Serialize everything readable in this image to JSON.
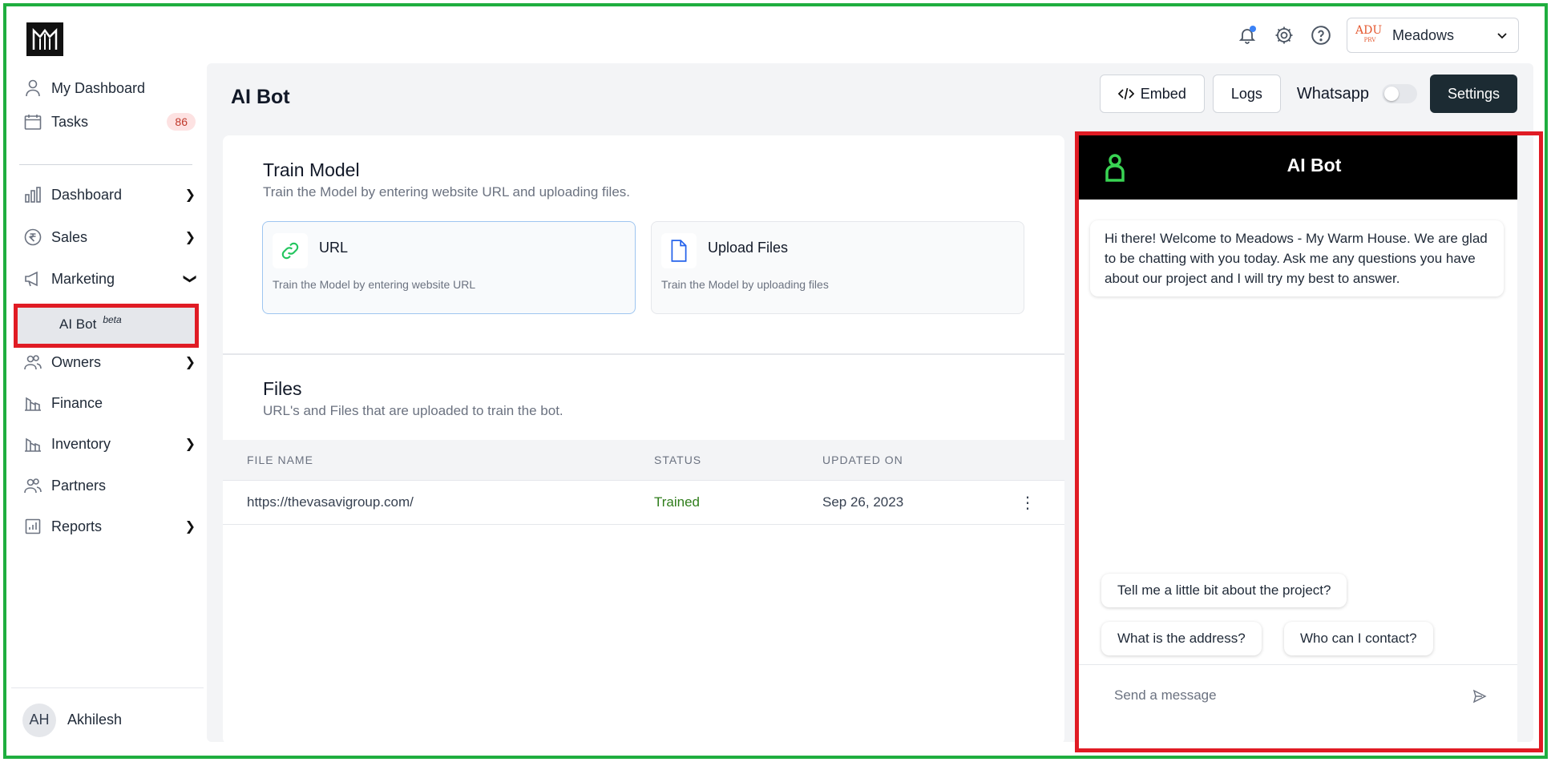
{
  "topbar": {
    "project_logo_text": "ADU",
    "project_logo_sub": "PRV",
    "project_name": "Meadows"
  },
  "sidebar": {
    "items": [
      {
        "label": "My Dashboard"
      },
      {
        "label": "Tasks",
        "badge": "86"
      },
      {
        "label": "Dashboard"
      },
      {
        "label": "Sales"
      },
      {
        "label": "Marketing"
      },
      {
        "label": "Owners"
      },
      {
        "label": "Finance"
      },
      {
        "label": "Inventory"
      },
      {
        "label": "Partners"
      },
      {
        "label": "Reports"
      }
    ],
    "sub_item": {
      "label": "AI Bot",
      "tag": "beta"
    },
    "user": {
      "initials": "AH",
      "name": "Akhilesh"
    }
  },
  "header": {
    "title": "AI Bot",
    "embed_label": "Embed",
    "logs_label": "Logs",
    "whatsapp_label": "Whatsapp",
    "whatsapp_enabled": false,
    "settings_label": "Settings"
  },
  "train": {
    "title": "Train Model",
    "subtitle": "Train the Model by entering website URL and uploading files.",
    "options": [
      {
        "label": "URL",
        "desc": "Train the Model by entering website URL"
      },
      {
        "label": "Upload Files",
        "desc": "Train the Model by uploading files"
      }
    ]
  },
  "files": {
    "title": "Files",
    "subtitle": "URL's and Files that are uploaded to train the bot.",
    "columns": [
      "FILE NAME",
      "STATUS",
      "UPDATED ON"
    ],
    "rows": [
      {
        "name": "https://thevasavigroup.com/",
        "status": "Trained",
        "updated": "Sep 26, 2023"
      }
    ]
  },
  "chat": {
    "title": "AI Bot",
    "greeting": "Hi there! Welcome to Meadows - My Warm House. We are glad to be chatting with you today. Ask me any questions you have about our project and I will try my best to answer.",
    "suggestions": [
      "Tell me a little bit about the project?",
      "What is the address?",
      "Who can I contact?"
    ],
    "input_placeholder": "Send a message"
  },
  "colors": {
    "accent_dark": "#1c2b33",
    "status_trained": "#2f7d1b",
    "highlight_red": "#e01b24",
    "frame_green": "#1fae3f",
    "bot_logo_green": "#39d353"
  }
}
